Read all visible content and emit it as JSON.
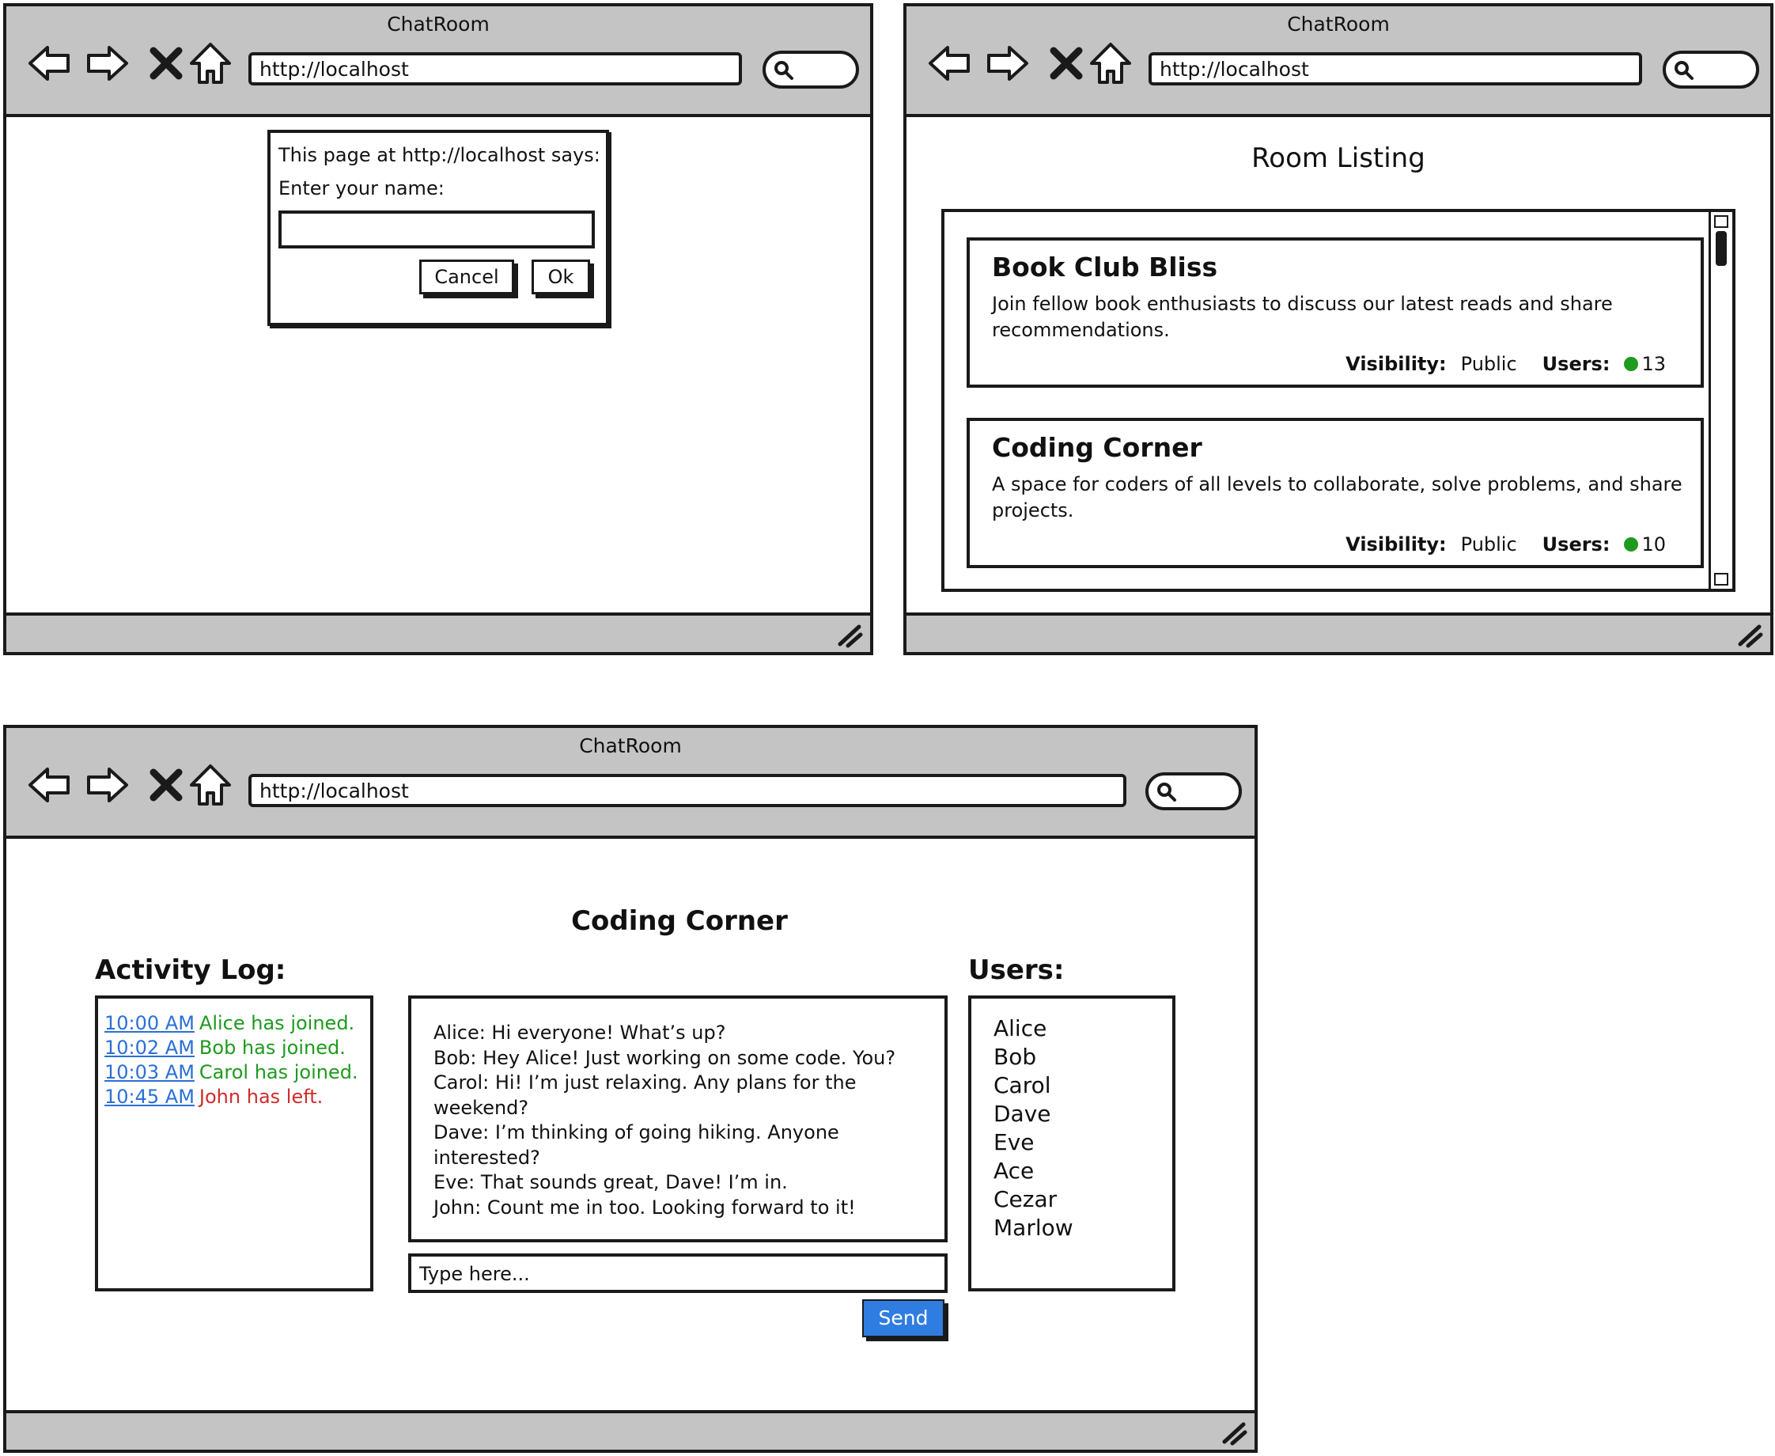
{
  "windows": [
    {
      "title": "ChatRoom",
      "url": "http://localhost",
      "dialog": {
        "message": "This page at http://localhost says:",
        "label": "Enter your name:",
        "input_value": "",
        "cancel_label": "Cancel",
        "ok_label": "Ok"
      }
    },
    {
      "title": "ChatRoom",
      "url": "http://localhost",
      "page_title": "Room Listing",
      "rooms": [
        {
          "name": "Book Club Bliss",
          "description": "Join fellow book enthusiasts to discuss our latest reads and share recommendations.",
          "visibility_label": "Visibility:",
          "visibility": "Public",
          "users_label": "Users:",
          "users": "13"
        },
        {
          "name": "Coding Corner",
          "description": "A space for coders of all levels to collaborate, solve problems, and share projects.",
          "visibility_label": "Visibility:",
          "visibility": "Public",
          "users_label": "Users:",
          "users": "10"
        }
      ]
    },
    {
      "title": "ChatRoom",
      "url": "http://localhost",
      "room_title": "Coding Corner",
      "activity_heading": "Activity Log:",
      "activity_log": [
        {
          "time": "10:00 AM",
          "text": "Alice has joined.",
          "type": "join"
        },
        {
          "time": "10:02 AM",
          "text": "Bob has joined.",
          "type": "join"
        },
        {
          "time": "10:03 AM",
          "text": "Carol has joined.",
          "type": "join"
        },
        {
          "time": "10:45 AM",
          "text": "John has left.",
          "type": "left"
        }
      ],
      "messages": [
        "Alice: Hi everyone! What’s up?",
        "Bob: Hey Alice! Just working on some code. You?",
        "Carol: Hi! I’m just relaxing. Any plans for the weekend?",
        "Dave: I’m thinking of going hiking. Anyone interested?",
        "Eve: That sounds great, Dave! I’m in.",
        "John: Count me in too. Looking forward to it!"
      ],
      "input_placeholder": "Type here...",
      "send_label": "Send",
      "users_heading": "Users:",
      "users": [
        "Alice",
        "Bob",
        "Carol",
        "Dave",
        "Eve",
        "Ace",
        "Cezar",
        "Marlow"
      ]
    }
  ],
  "colors": {
    "chrome": "#c4c4c4",
    "join": "#1e9a1e",
    "left": "#d12b2b",
    "link": "#2a6fd8",
    "send_button": "#2f7de1",
    "online_dot": "#1e9a1e"
  },
  "icons": [
    "back-arrow-icon",
    "forward-arrow-icon",
    "stop-icon",
    "home-icon",
    "search-icon",
    "resize-grip-icon"
  ]
}
